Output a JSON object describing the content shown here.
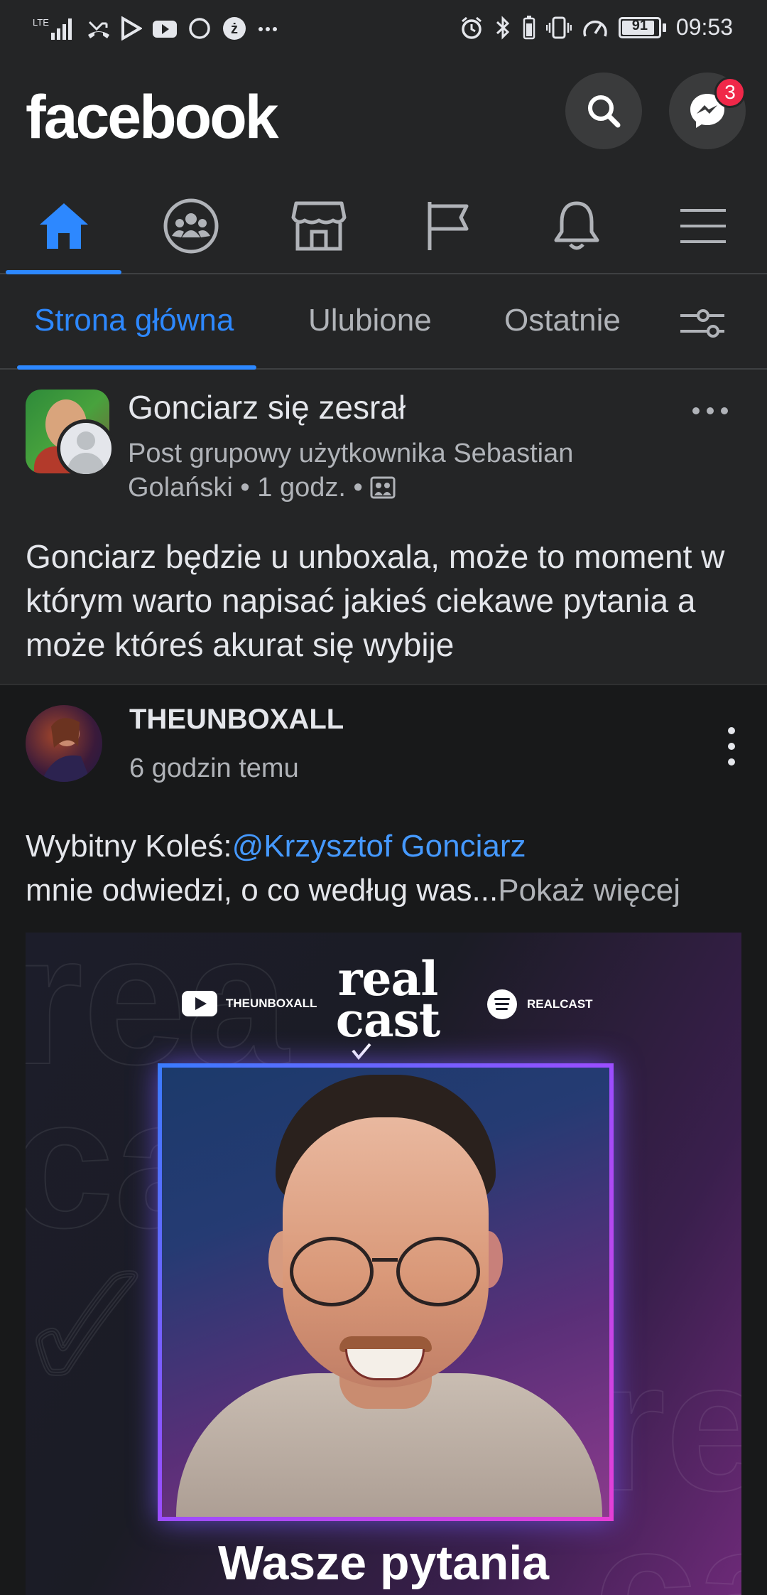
{
  "status_bar": {
    "network": "LTE",
    "icons_left": [
      "signal-icon",
      "missed-call-icon",
      "play-store-icon",
      "youtube-icon",
      "circle-icon",
      "zabka-icon",
      "more-notifications-icon"
    ],
    "icons_right": [
      "alarm-icon",
      "bluetooth-icon",
      "vibrate-icon",
      "speed-icon",
      "battery-icon"
    ],
    "battery": "91",
    "battery_level": 0.91,
    "time": "09:53"
  },
  "header": {
    "logo": "facebook",
    "messenger_badge": "3"
  },
  "nav_tabs": {
    "items": [
      {
        "id": "home",
        "icon": "home-icon",
        "active": true
      },
      {
        "id": "groups",
        "icon": "groups-icon",
        "active": false
      },
      {
        "id": "marketplace",
        "icon": "marketplace-icon",
        "active": false
      },
      {
        "id": "pages",
        "icon": "flag-icon",
        "active": false
      },
      {
        "id": "notifications",
        "icon": "bell-icon",
        "active": false
      },
      {
        "id": "menu",
        "icon": "hamburger-menu-icon",
        "active": false
      }
    ],
    "active_color": "#2d88ff"
  },
  "feed_tabs": {
    "home": "Strona główna",
    "favorites": "Ulubione",
    "recent": "Ostatnie"
  },
  "post": {
    "group_name": "Gonciarz się zesrał",
    "meta_line1": "Post grupowy użytkownika Sebastian",
    "meta_line2": "Golański • 1 godz. •",
    "text": "Gonciarz będzie u unboxala, może to moment w którym warto napisać jakieś ciekawe pytania a może któreś akurat się wybije"
  },
  "shared": {
    "channel_name": "THEUNBOXALL",
    "time": "6 godzin temu",
    "caption_prefix": "Wybitny Koleś:",
    "mention": "@Krzysztof Gonciarz",
    "caption_rest": "mnie odwiedzi, o co według was",
    "ellipsis": "...",
    "show_more": "Pokaż więcej",
    "thumbnail": {
      "yt_label": "THEUNBOXALL",
      "logo_line1": "real",
      "logo_line2": "cast",
      "spotify_label": "REALCAST",
      "title": "Wasze pytania"
    }
  },
  "colors": {
    "background": "#242526",
    "accent": "#2d88ff",
    "badge": "#f02849",
    "mention": "#4599ff"
  }
}
